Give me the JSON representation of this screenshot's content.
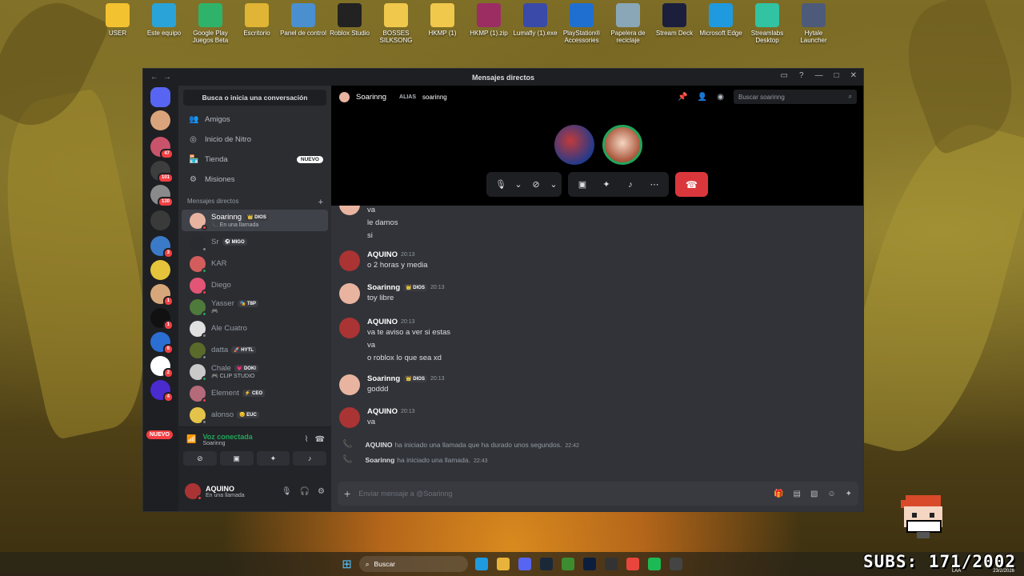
{
  "desktop": {
    "icons": [
      {
        "label": "USER",
        "icon": "user-folder-icon",
        "color": "#f2c230"
      },
      {
        "label": "Este equipo",
        "icon": "monitor-icon",
        "color": "#2aa4d8"
      },
      {
        "label": "Google Play Juegos Beta",
        "icon": "google-play-icon",
        "color": "#2fb36a"
      },
      {
        "label": "Escritorio",
        "icon": "folder-icon",
        "color": "#e0b434"
      },
      {
        "label": "Panel de control",
        "icon": "control-panel-icon",
        "color": "#4a8fd0"
      },
      {
        "label": "Roblox Studio",
        "icon": "roblox-icon",
        "color": "#222222"
      },
      {
        "label": "BOSSES SILKSONG",
        "icon": "folder-icon",
        "color": "#f0c84c"
      },
      {
        "label": "HKMP (1)",
        "icon": "folder-icon",
        "color": "#f0c84c"
      },
      {
        "label": "HKMP (1).zip",
        "icon": "winrar-icon",
        "color": "#9c2d63"
      },
      {
        "label": "Lumafly (1).exe",
        "icon": "lumafly-icon",
        "color": "#3a4aa8"
      },
      {
        "label": "PlayStation® Accessories",
        "icon": "playstation-icon",
        "color": "#1f6fd1"
      },
      {
        "label": "Papelera de reciclaje",
        "icon": "recycle-bin-icon",
        "color": "#8aa7b8"
      },
      {
        "label": "Stream Deck",
        "icon": "stream-deck-icon",
        "color": "#1b1f3c"
      },
      {
        "label": "Microsoft Edge",
        "icon": "edge-icon",
        "color": "#1f9adf"
      },
      {
        "label": "Streamlabs Desktop",
        "icon": "streamlabs-icon",
        "color": "#31c3a2"
      },
      {
        "label": "Hytale Launcher",
        "icon": "hytale-icon",
        "color": "#4d5a7a"
      }
    ]
  },
  "window": {
    "title": "Mensajes directos",
    "back": "←",
    "forward": "→"
  },
  "servers": [
    {
      "badge": "",
      "color": "#5865f2"
    },
    {
      "badge": "",
      "color": "#d9a47c"
    },
    {
      "badge": "47",
      "color": "#c9536b"
    },
    {
      "badge": "101",
      "color": "#3d3d3d"
    },
    {
      "badge": "130",
      "color": "#8a8a8a"
    },
    {
      "badge": "",
      "color": "#3a3a3a"
    },
    {
      "badge": "3",
      "color": "#3b7ac7"
    },
    {
      "badge": "",
      "color": "#e5c43b"
    },
    {
      "badge": "1",
      "color": "#d6a77a"
    },
    {
      "badge": "1",
      "color": "#111111"
    },
    {
      "badge": "6",
      "color": "#2a6fd1"
    },
    {
      "badge": "2",
      "color": "#ffffff"
    },
    {
      "badge": "4",
      "color": "#4a2bd0"
    }
  ],
  "new_badge": "NUEVO",
  "sidebar": {
    "search": "Busca o inicia una conversación",
    "nav": [
      {
        "label": "Amigos",
        "icon": "friends-icon"
      },
      {
        "label": "Inicio de Nitro",
        "icon": "nitro-icon"
      },
      {
        "label": "Tienda",
        "icon": "shop-icon",
        "badge": "NUEVO"
      },
      {
        "label": "Misiones",
        "icon": "quests-icon"
      }
    ],
    "dm_header": "Mensajes directos",
    "dm_add": "+",
    "dms": [
      {
        "name": "Soarinng",
        "tag": "👑 DIOS",
        "sub": "📞 En una llamada",
        "color": "#e8b4a0",
        "status": "#f23f43",
        "active": true
      },
      {
        "name": "Sr",
        "tag": "⚽ MIGO",
        "sub": "",
        "color": "#2a2b30",
        "status": "#80848e"
      },
      {
        "name": "KAR",
        "tag": "",
        "sub": "",
        "color": "#d35c5c",
        "status": "#23a55a"
      },
      {
        "name": "Diego",
        "tag": "",
        "sub": "",
        "color": "#e25575",
        "status": "#f23f43"
      },
      {
        "name": "Yasser",
        "tag": "🎭 T8P",
        "sub": "🎮",
        "color": "#4e7a3c",
        "status": "#23a55a"
      },
      {
        "name": "Ale Cuatro",
        "tag": "",
        "sub": "",
        "color": "#e0e0e0",
        "status": "#80848e"
      },
      {
        "name": "datta",
        "tag": "🚀 HYTL",
        "sub": "",
        "color": "#5a6a2a",
        "status": "#80848e"
      },
      {
        "name": "Chale",
        "tag": "💗 DOKI",
        "sub": "🎮 CLIP STUDIO",
        "color": "#c9c9c9",
        "status": "#23a55a"
      },
      {
        "name": "Element",
        "tag": "⚡ CEO",
        "sub": "",
        "color": "#b56a7a",
        "status": "#f23f43"
      },
      {
        "name": "alonso",
        "tag": "😊 EUC",
        "sub": "",
        "color": "#e3c34a",
        "status": "#80848e"
      }
    ]
  },
  "voice": {
    "title": "Voz conectada",
    "channel": "Soarinng"
  },
  "user": {
    "name": "AQUINO",
    "status": "En una llamada"
  },
  "channel": {
    "name": "Soarinng",
    "alias_label": "ALIAS",
    "alias_value": "soarinng",
    "search_placeholder": "Buscar soarinng"
  },
  "messages": [
    {
      "kind": "cont",
      "lines": [
        "va",
        "le damos",
        "si"
      ]
    },
    {
      "kind": "msg",
      "author": "AQUINO",
      "tag": "",
      "time": "20:13",
      "lines": [
        "o 2 horas y media"
      ],
      "color": "#a33"
    },
    {
      "kind": "msg",
      "author": "Soarinng",
      "tag": "👑 DIOS",
      "time": "20:13",
      "lines": [
        "toy libre"
      ],
      "color": "#e8b4a0"
    },
    {
      "kind": "msg",
      "author": "AQUINO",
      "tag": "",
      "time": "20:13",
      "lines": [
        "va te aviso a ver si estas",
        "va",
        "o roblox lo que sea xd"
      ],
      "color": "#a33"
    },
    {
      "kind": "msg",
      "author": "Soarinng",
      "tag": "👑 DIOS",
      "time": "20:13",
      "lines": [
        "goddd"
      ],
      "color": "#e8b4a0"
    },
    {
      "kind": "msg",
      "author": "AQUINO",
      "tag": "",
      "time": "20:13",
      "lines": [
        "va"
      ],
      "color": "#a33"
    }
  ],
  "system_messages": [
    {
      "author": "AQUINO",
      "text": "ha iniciado una llamada que ha durado unos segundos.",
      "time": "22:42"
    },
    {
      "author": "Soarinng",
      "text": "ha iniciado una llamada.",
      "time": "22:43"
    }
  ],
  "composer": {
    "placeholder": "Enviar mensaje a @Soarinng"
  },
  "taskbar": {
    "search": "Buscar",
    "apps": [
      {
        "icon": "edge-icon",
        "color": "#1f9adf"
      },
      {
        "icon": "file-explorer-icon",
        "color": "#e8b33a"
      },
      {
        "icon": "discord-icon",
        "color": "#5865f2"
      },
      {
        "icon": "steam-icon",
        "color": "#1b2838"
      },
      {
        "icon": "minecraft-icon",
        "color": "#3d8c2f"
      },
      {
        "icon": "photoshop-icon",
        "color": "#0c1e3e"
      },
      {
        "icon": "obs-icon",
        "color": "#333333"
      },
      {
        "icon": "chrome-icon",
        "color": "#e8453c"
      },
      {
        "icon": "spotify-icon",
        "color": "#1db954"
      },
      {
        "icon": "xbox-icon",
        "color": "#444444"
      }
    ]
  },
  "overlay": {
    "subs": "SUBS: 171/2002",
    "lang": "LAA",
    "date": "23/2/2026"
  }
}
